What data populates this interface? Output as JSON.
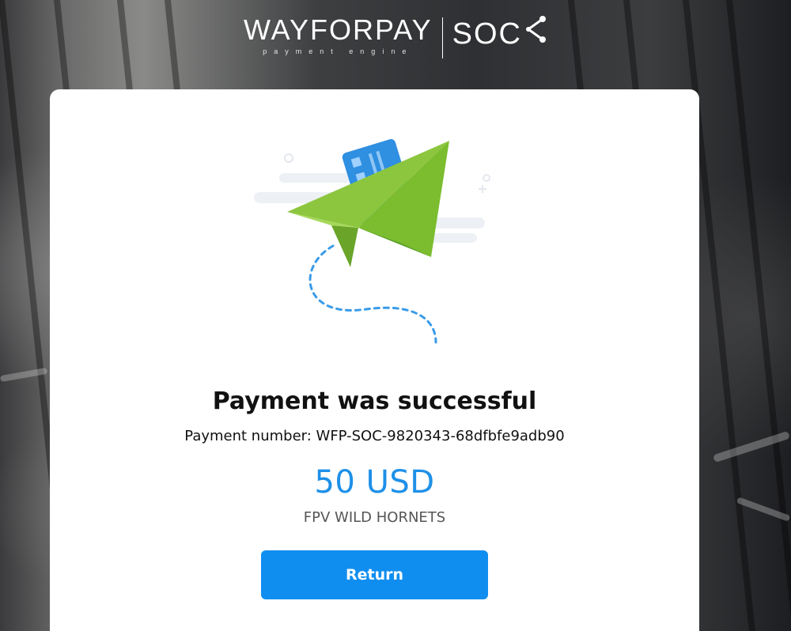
{
  "brand": {
    "name": "WAYFORPAY",
    "tagline": "payment engine",
    "partner": "SOC"
  },
  "result": {
    "title": "Payment was successful",
    "payment_number_label": "Payment number:",
    "payment_number": "WFP-SOC-9820343-68dfbfe9adb90",
    "payment_number_line": "Payment number: WFP-SOC-9820343-68dfbfe9adb90",
    "amount": "50 USD",
    "merchant": "FPV WILD HORNETS"
  },
  "actions": {
    "return_label": "Return"
  },
  "colors": {
    "accent": "#1e90e8",
    "button": "#108ef0",
    "plane_light": "#8cc63f",
    "plane_dark": "#5a9e2a",
    "card_blue": "#2f8fe0",
    "card_chip": "#e04a4a"
  },
  "icons": {
    "illustration": "paper-plane-with-card-icon",
    "share": "share-icon",
    "lock": "lock-icon"
  }
}
